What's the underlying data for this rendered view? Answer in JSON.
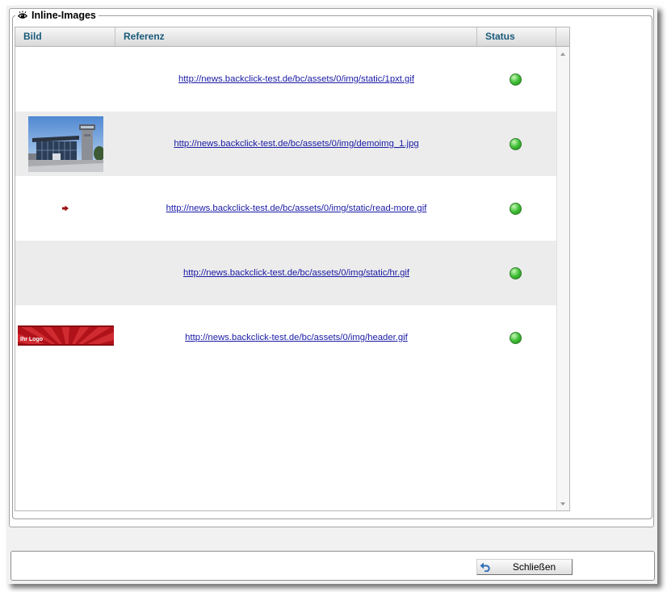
{
  "panel": {
    "legend": "Inline-Images",
    "legend_icon": "eye-icon"
  },
  "table": {
    "columns": {
      "image": "Bild",
      "reference": "Referenz",
      "status": "Status"
    },
    "rows": [
      {
        "thumbnail_icon": "blank-image",
        "reference": "http://news.backclick-test.de/bc/assets/0/img/static/1pxt.gif",
        "status_icon": "green-status-dot"
      },
      {
        "thumbnail_icon": "photo-thumbnail",
        "reference": "http://news.backclick-test.de/bc/assets/0/img/demoimg_1.jpg",
        "status_icon": "green-status-dot"
      },
      {
        "thumbnail_icon": "red-arrow-icon",
        "reference": "http://news.backclick-test.de/bc/assets/0/img/static/read-more.gif",
        "status_icon": "green-status-dot"
      },
      {
        "thumbnail_icon": "blank-image",
        "reference": "http://news.backclick-test.de/bc/assets/0/img/static/hr.gif",
        "status_icon": "green-status-dot"
      },
      {
        "thumbnail_icon": "logo-banner-image",
        "logo_text": "Ihr Logo",
        "reference": "http://news.backclick-test.de/bc/assets/0/img/header.gif",
        "status_icon": "green-status-dot"
      }
    ]
  },
  "scrollbar": {
    "up_icon": "scroll-up-arrow-icon",
    "down_icon": "scroll-down-arrow-icon"
  },
  "footer": {
    "close_label": "Schließen",
    "close_icon": "undo-arrow-icon"
  },
  "colors": {
    "header_text": "#1a5a7a",
    "link": "#1a1aa6",
    "row_alt": "#ececec",
    "status_ok": "#3fbf36"
  }
}
